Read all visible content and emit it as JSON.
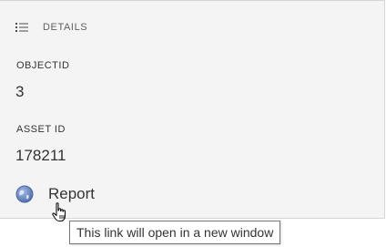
{
  "header": {
    "icon": "list-icon",
    "title": "DETAILS"
  },
  "fields": [
    {
      "label": "OBJECTID",
      "value": "3"
    },
    {
      "label": "ASSET ID",
      "value": "178211"
    }
  ],
  "link": {
    "icon": "globe-icon",
    "label": "Report",
    "tooltip": "This link will open in a new window"
  },
  "colors": {
    "panel_background": "#f4f4f4",
    "text": "#333333",
    "globe": "#5b7bb8"
  }
}
